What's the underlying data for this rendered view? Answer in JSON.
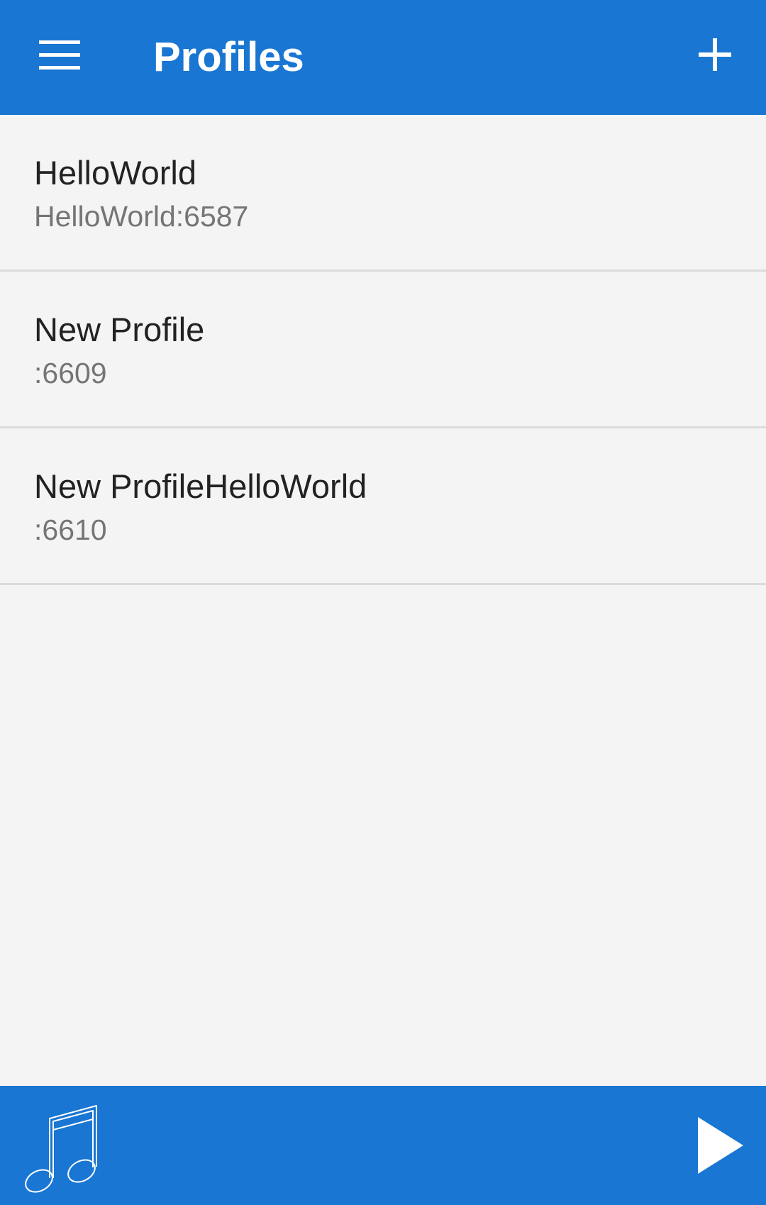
{
  "app_bar": {
    "title": "Profiles",
    "menu_icon": "hamburger-menu-icon",
    "add_icon": "plus-icon",
    "background_color": "#1976d2"
  },
  "profiles": [
    {
      "name": "HelloWorld",
      "address": "HelloWorld:6587"
    },
    {
      "name": "New Profile",
      "address": ":6609"
    },
    {
      "name": "New ProfileHelloWorld",
      "address": ":6610"
    }
  ],
  "bottom_bar": {
    "music_icon": "music-note-icon",
    "play_icon": "play-icon",
    "background_color": "#1976d2"
  }
}
